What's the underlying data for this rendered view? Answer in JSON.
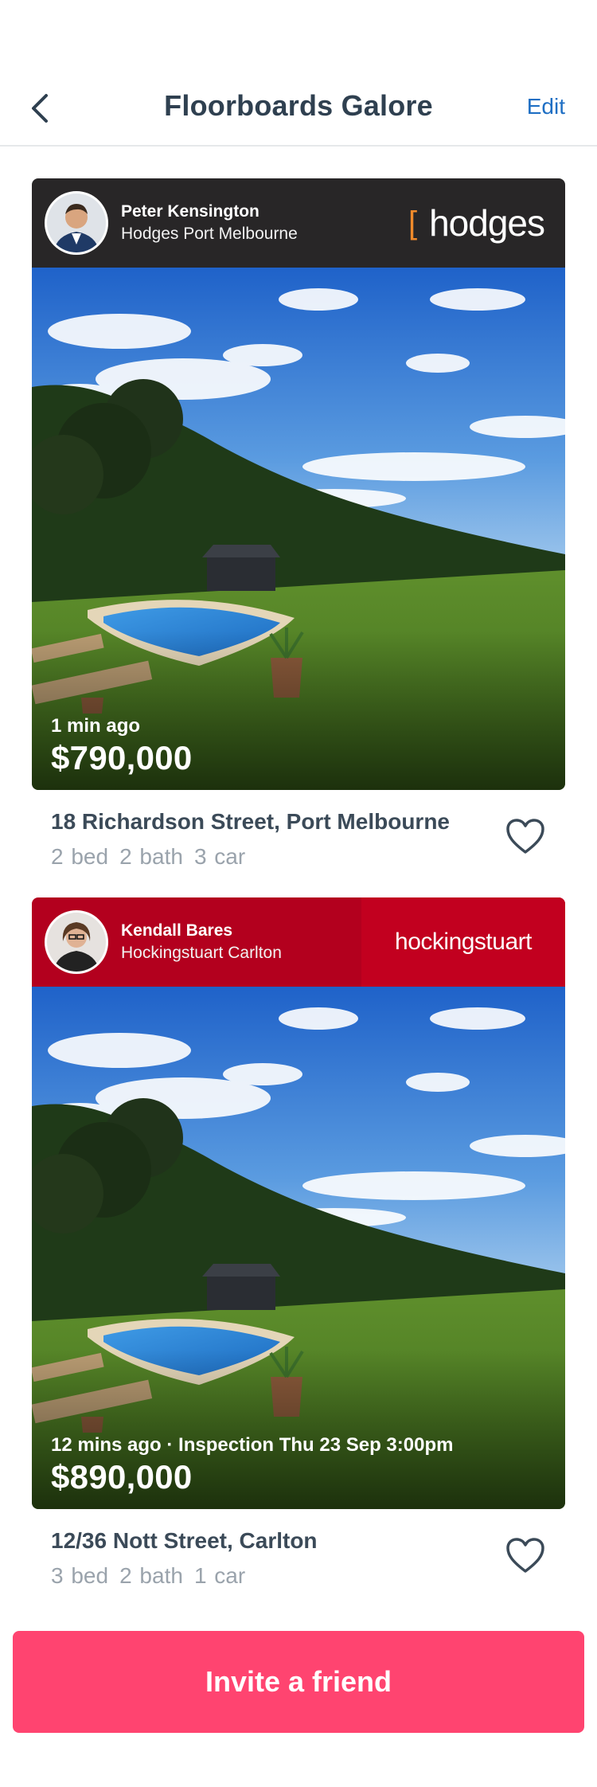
{
  "header": {
    "title": "Floorboards Galore",
    "edit_label": "Edit"
  },
  "listings": [
    {
      "agent_name": "Peter Kensington",
      "agency_name": "Hodges Port Melbourne",
      "brand": "hodges",
      "brand_color": "#282627",
      "meta": "1 min ago",
      "price": "$790,000",
      "address": "18 Richardson Street, Port Melbourne",
      "beds": "2 bed",
      "baths": "2 bath",
      "cars": "3 car"
    },
    {
      "agent_name": "Kendall Bares",
      "agency_name": "Hockingstuart Carlton",
      "brand": "hockingstuart",
      "brand_color": "#b3001e",
      "meta": "12 mins ago · Inspection Thu 23 Sep 3:00pm",
      "price": "$890,000",
      "address": "12/36 Nott Street, Carlton",
      "beds": "3 bed",
      "baths": "2 bath",
      "cars": "1 car"
    }
  ],
  "invite_label": "Invite a friend",
  "colors": {
    "accent_pink": "#ff4470",
    "link_blue": "#1f6fc4",
    "hodges_orange": "#f08a2b"
  }
}
